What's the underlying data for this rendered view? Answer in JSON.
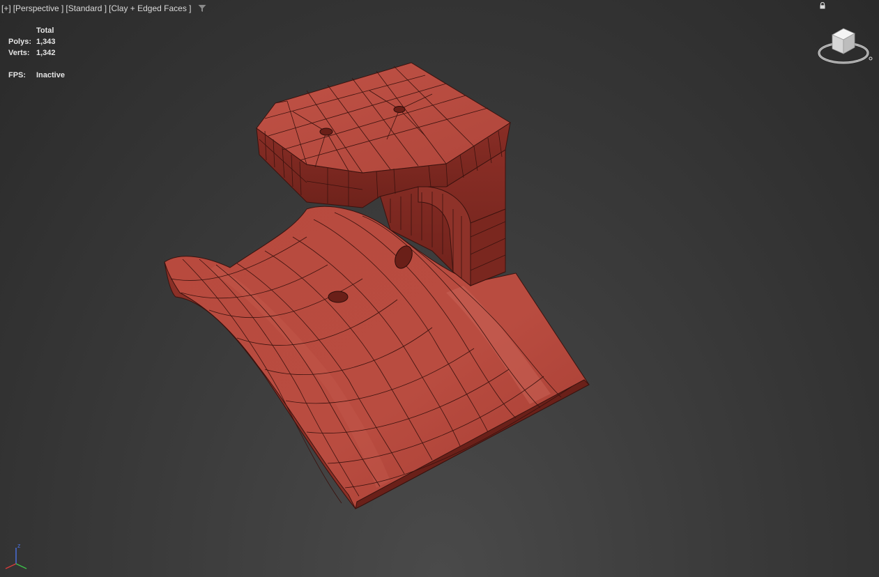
{
  "viewport": {
    "labels": [
      "[+]",
      "[Perspective ]",
      "[Standard ]",
      "[Clay + Edged Faces ]"
    ],
    "filter_icon": "filter-icon"
  },
  "stats": {
    "header": "Total",
    "polys_label": "Polys:",
    "polys_value": "1,343",
    "verts_label": "Verts:",
    "verts_value": "1,342",
    "fps_label": "FPS:",
    "fps_value": "Inactive"
  },
  "gizmo": {
    "z_label": "z"
  },
  "colors": {
    "clay": "#b5443a",
    "clay_dark": "#7e2a22",
    "clay_light": "#c95a4c",
    "edge": "#3a120e"
  }
}
